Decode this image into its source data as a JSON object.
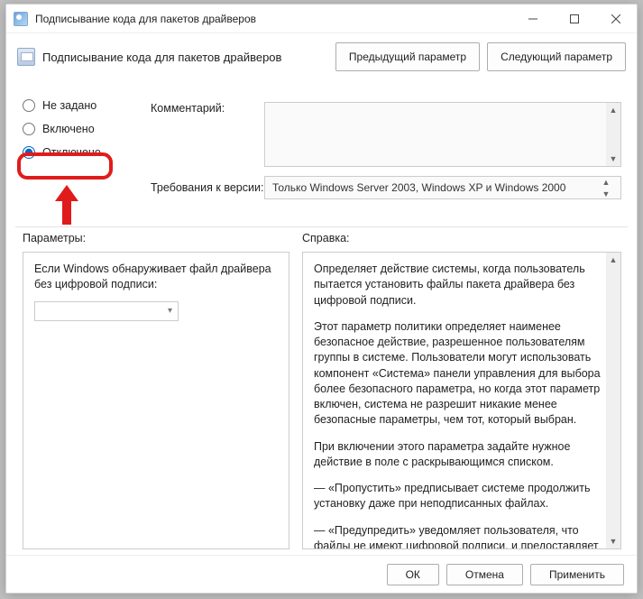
{
  "titlebar": {
    "title": "Подписывание кода для пакетов драйверов"
  },
  "header": {
    "title": "Подписывание кода для пакетов драйверов",
    "prev": "Предыдущий параметр",
    "next": "Следующий параметр"
  },
  "radios": {
    "not_configured": "Не задано",
    "enabled": "Включено",
    "disabled": "Отключено"
  },
  "labels": {
    "comment": "Комментарий:",
    "requirements": "Требования к версии:",
    "params": "Параметры:",
    "help": "Справка:"
  },
  "requirements_value": "Только Windows Server 2003, Windows XP и Windows 2000",
  "left_panel": {
    "text": "Если Windows обнаруживает файл драйвера без цифровой подписи:"
  },
  "help": {
    "p1": "Определяет действие системы, когда пользователь пытается установить файлы пакета драйвера без цифровой подписи.",
    "p2": "Этот параметр политики определяет наименее безопасное действие, разрешенное пользователям группы в системе. Пользователи могут использовать компонент «Система» панели управления для выбора более безопасного параметра, но когда этот параметр включен, система не разрешит никакие менее безопасные параметры, чем тот, который выбран.",
    "p3": "При включении этого параметра задайте нужное действие в поле с раскрывающимся списком.",
    "p4": "—   «Пропустить» предписывает системе продолжить установку даже при неподписанных файлах.",
    "p5": "—   «Предупредить» уведомляет пользователя, что файлы не имеют цифровой подписи, и предоставляет пользователю возможность решить, остановить установку или продолжить, и разрешить ли установку неподписанных файлов. Параметр"
  },
  "footer": {
    "ok": "ОК",
    "cancel": "Отмена",
    "apply": "Применить"
  }
}
